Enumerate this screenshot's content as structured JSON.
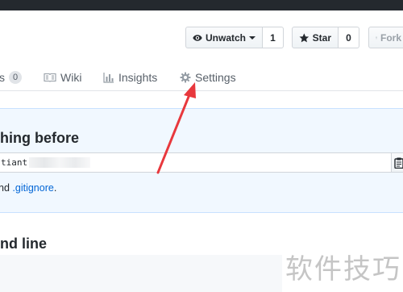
{
  "repo_actions": {
    "watch_label": "Unwatch",
    "watch_count": "1",
    "star_label": "Star",
    "star_count": "0",
    "fork_label": "Fork"
  },
  "tabs": [
    {
      "label": "s",
      "badge": "0"
    },
    {
      "label": "Wiki"
    },
    {
      "label": "Insights"
    },
    {
      "label": "Settings"
    }
  ],
  "quick_setup": {
    "title": "hing before",
    "clone_url_visible": "tiant",
    "note_prefix": "nd ",
    "note_link": ".gitignore",
    "note_suffix": "."
  },
  "section2": {
    "title": "nd line"
  },
  "watermark": "软件技巧",
  "annotation": {
    "color": "#e8383d"
  }
}
